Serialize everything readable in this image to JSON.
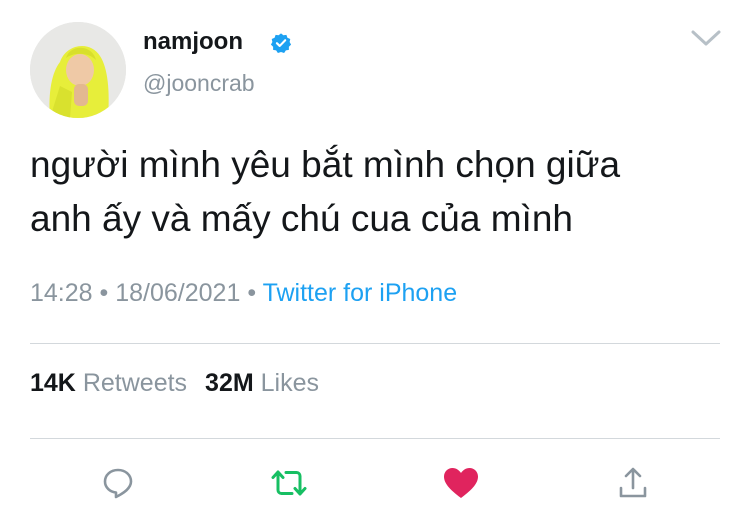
{
  "author": {
    "display_name": "namjoon",
    "handle": "@jooncrab",
    "verified_icon": "verified-badge-icon",
    "avatar_icon": "profile-avatar"
  },
  "tweet": {
    "lines": [
      "người mình yêu bắt mình chọn giữa",
      "anh ấy và mấy chú cua của mình"
    ],
    "time": "14:28",
    "date": "18/06/2021",
    "source": "Twitter for iPhone",
    "separator": "•"
  },
  "stats": {
    "retweets_count": "14K",
    "retweets_label": "Retweets",
    "likes_count": "32M",
    "likes_label": "Likes"
  },
  "actions": [
    {
      "name": "reply",
      "icon": "reply-bubble-icon",
      "color": "#8a959e"
    },
    {
      "name": "retweet",
      "icon": "retweet-icon",
      "color": "#17bf63"
    },
    {
      "name": "like",
      "icon": "heart-icon",
      "color": "#e0245e"
    },
    {
      "name": "share",
      "icon": "share-icon",
      "color": "#8a959e"
    }
  ],
  "colors": {
    "accent": "#1da1f2",
    "muted": "#8a959e",
    "retweet_active": "#17bf63",
    "like_active": "#e0245e"
  }
}
